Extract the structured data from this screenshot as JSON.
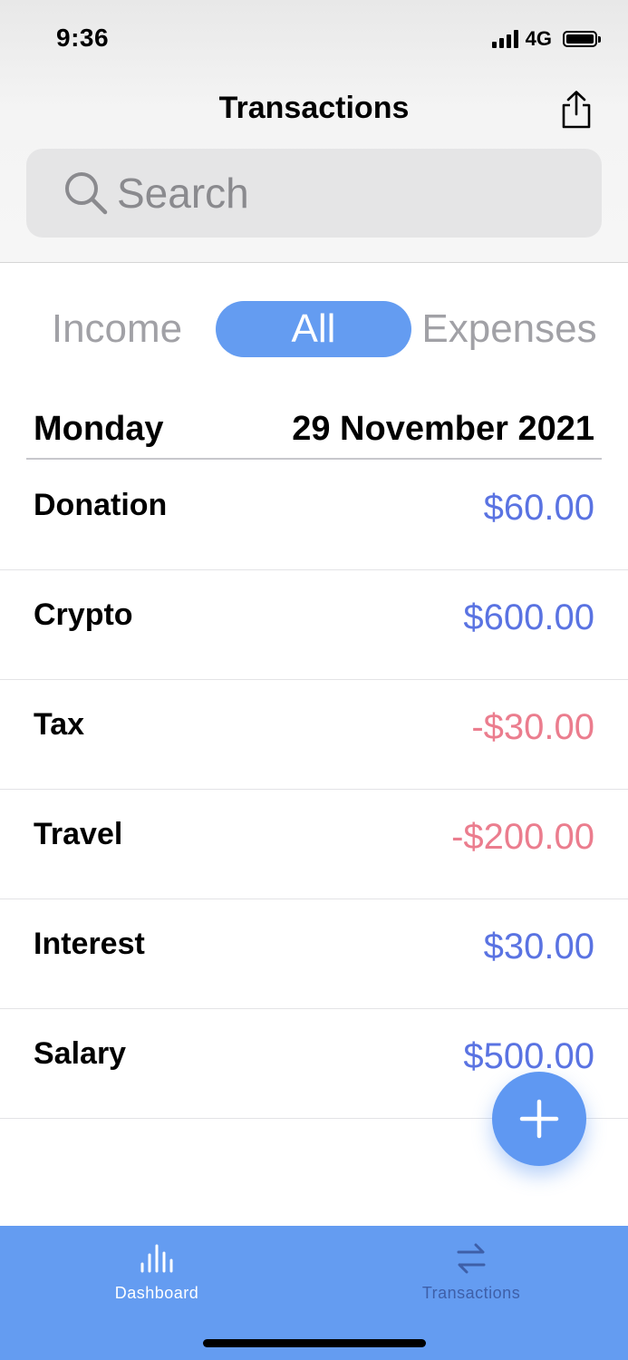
{
  "status_bar": {
    "time": "9:36",
    "network": "4G"
  },
  "header": {
    "title": "Transactions",
    "share_icon": "share-icon"
  },
  "search": {
    "placeholder": "Search"
  },
  "filters": {
    "income": "Income",
    "all": "All",
    "expenses": "Expenses",
    "selected": "All"
  },
  "date_section": {
    "day": "Monday",
    "date": "29 November 2021"
  },
  "transactions": [
    {
      "name": "Donation",
      "amount": "$60.00",
      "type": "income"
    },
    {
      "name": "Crypto",
      "amount": "$600.00",
      "type": "income"
    },
    {
      "name": "Tax",
      "amount": "-$30.00",
      "type": "expense"
    },
    {
      "name": "Travel",
      "amount": "-$200.00",
      "type": "expense"
    },
    {
      "name": "Interest",
      "amount": "$30.00",
      "type": "income"
    },
    {
      "name": "Salary",
      "amount": "$500.00",
      "type": "income"
    }
  ],
  "colors": {
    "accent": "#649cf1",
    "income": "#5a73e2",
    "expense": "#eb7d8e",
    "inactive_tab": "#3e5fa8"
  },
  "tab_bar": {
    "dashboard": "Dashboard",
    "transactions": "Transactions",
    "active": "Dashboard"
  }
}
